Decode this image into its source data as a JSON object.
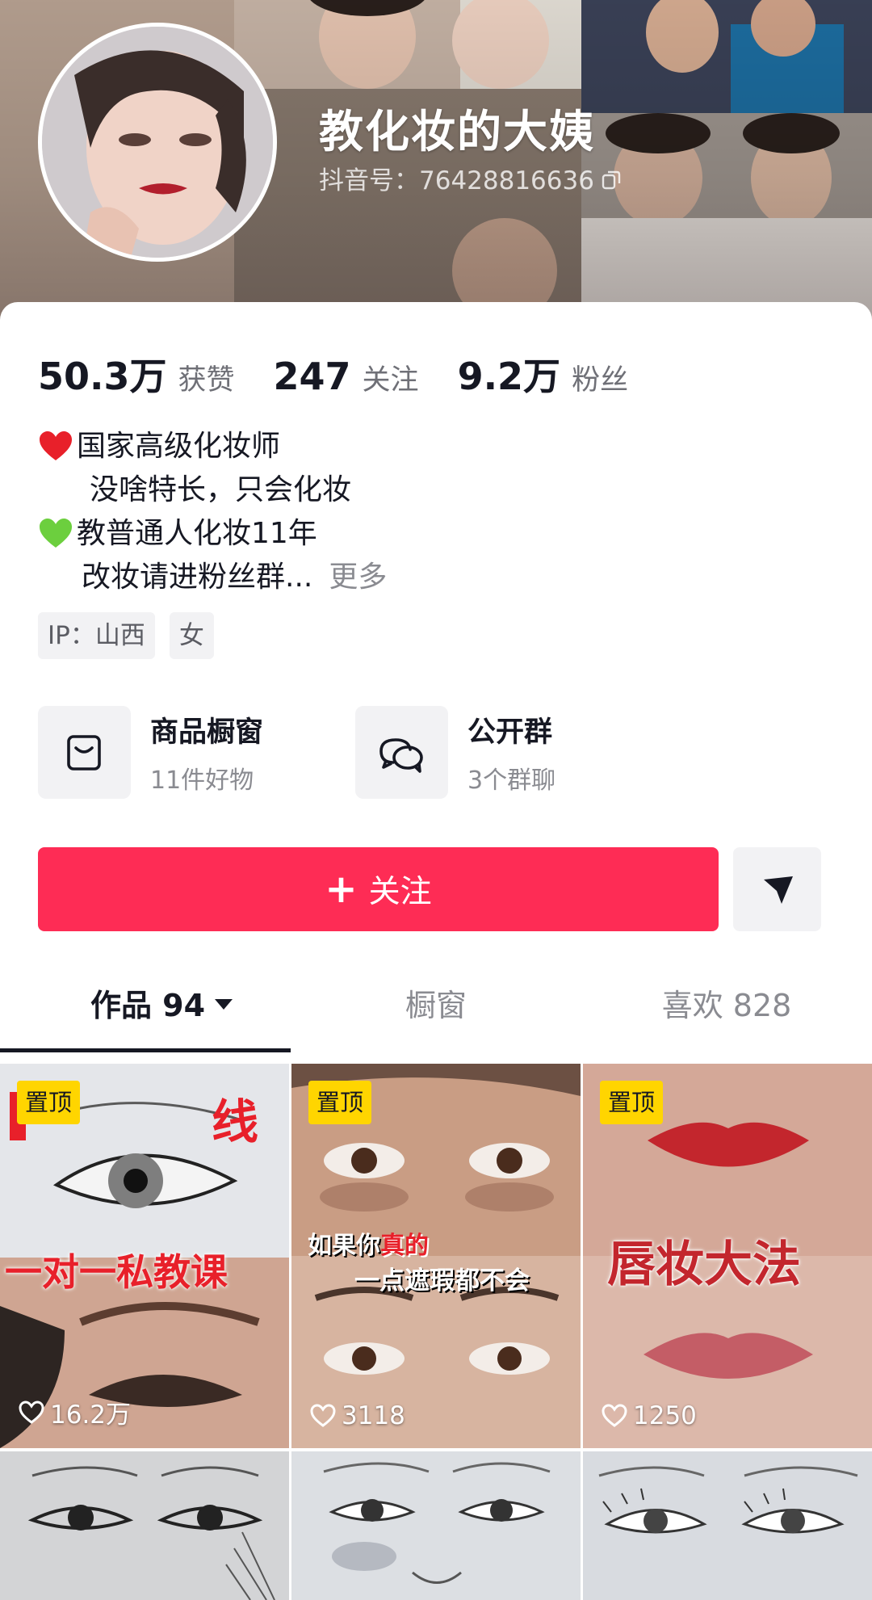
{
  "profile": {
    "name": "教化妆的大姨",
    "douyin_id": "抖音号：76428816636"
  },
  "stats": [
    {
      "value": "50.3万",
      "label": "获赞"
    },
    {
      "value": "247",
      "label": "关注"
    },
    {
      "value": "9.2万",
      "label": "粉丝"
    }
  ],
  "bio": {
    "line1": "国家高级化妆师",
    "line2": "没啥特长，只会化妆",
    "line3": "教普通人化妆11年",
    "line4": "改妆请进粉丝群...",
    "more": "更多"
  },
  "tags": [
    "IP：山西",
    "女"
  ],
  "features": [
    {
      "title": "商品橱窗",
      "subtitle": "11件好物",
      "icon": "shopping-bag-icon"
    },
    {
      "title": "公开群",
      "subtitle": "3个群聊",
      "icon": "group-chat-icon"
    }
  ],
  "actions": {
    "follow_label": "关注",
    "follow_plus": "+"
  },
  "tabs": [
    {
      "label": "作品 94",
      "active": true
    },
    {
      "label": "橱窗",
      "active": false
    },
    {
      "label": "喜欢 828",
      "active": false
    }
  ],
  "videos": [
    {
      "pinned": "置顶",
      "title_top": "线",
      "title_main": "一对一私教课",
      "likes": "16.2万"
    },
    {
      "pinned": "置顶",
      "caption1": "如果你",
      "caption_highlight": "真的",
      "caption2": "一点遮瑕都不会",
      "likes": "3118"
    },
    {
      "pinned": "置顶",
      "title_main": "唇妆大法",
      "likes": "1250"
    }
  ],
  "colors": {
    "accent": "#fe2c55",
    "pin_badge": "#ffd500",
    "text_primary": "#161823",
    "text_secondary": "#8a8b91"
  }
}
